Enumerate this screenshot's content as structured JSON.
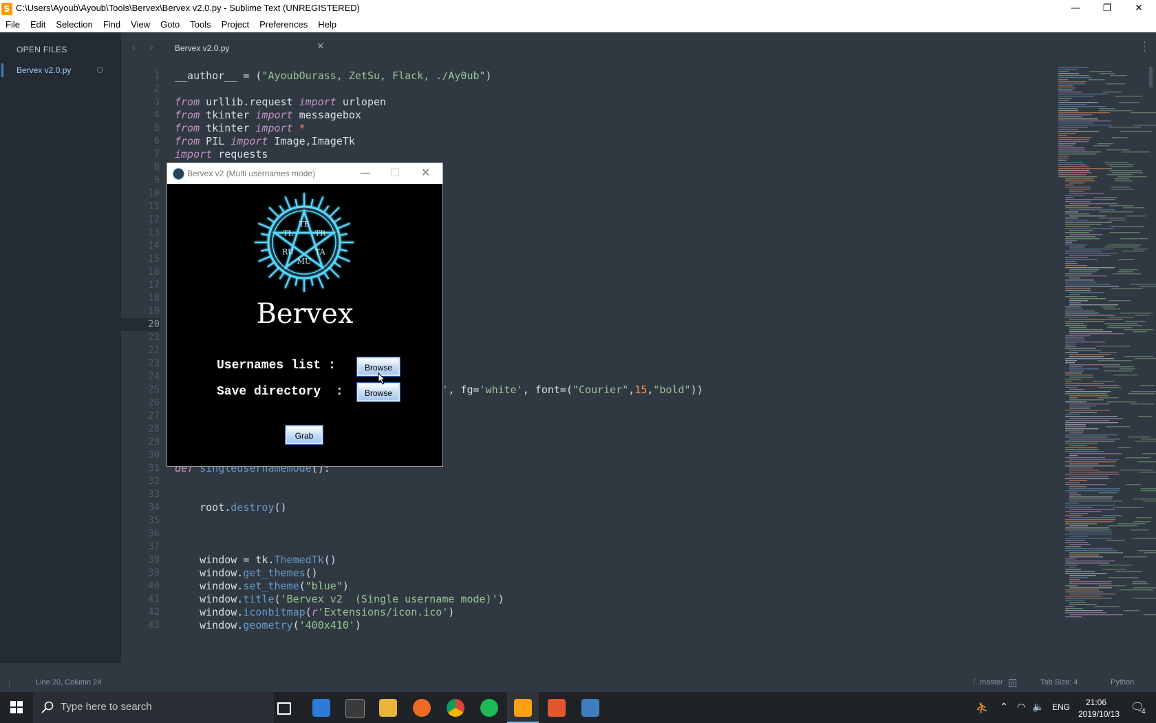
{
  "window": {
    "title": "C:\\Users\\Ayoub\\Ayoub\\Tools\\Bervex\\Bervex v2.0.py - Sublime Text (UNREGISTERED)",
    "minimize_glyph": "—",
    "maximize_glyph": "❐",
    "close_glyph": "✕"
  },
  "menu": [
    "File",
    "Edit",
    "Selection",
    "Find",
    "View",
    "Goto",
    "Tools",
    "Project",
    "Preferences",
    "Help"
  ],
  "sidebar": {
    "header": "OPEN FILES",
    "files": [
      {
        "label": "Bervex v2.0.py"
      }
    ]
  },
  "tabs": [
    {
      "label": "Bervex v2.0.py",
      "close": "×"
    }
  ],
  "editor": {
    "current_line": 20,
    "lines": [
      {
        "n": 1,
        "html": "__author__ = (<span class='str'>\"AyoubOurass, ZetSu, Flack, ./Ay0ub\"</span>)"
      },
      {
        "n": 2,
        "html": ""
      },
      {
        "n": 3,
        "html": "<span class='kw'>from</span> urllib.request <span class='kw'>import</span> urlopen"
      },
      {
        "n": 4,
        "html": "<span class='kw'>from</span> tkinter <span class='kw'>import</span> messagebox"
      },
      {
        "n": 5,
        "html": "<span class='kw'>from</span> tkinter <span class='kw'>import</span> <span class='op'>*</span>"
      },
      {
        "n": 6,
        "html": "<span class='kw'>from</span> PIL <span class='kw'>import</span> Image,ImageTk"
      },
      {
        "n": 7,
        "html": "<span class='kw'>import</span> requests"
      },
      {
        "n": 8,
        "html": ""
      },
      {
        "n": 9,
        "html": ""
      },
      {
        "n": 10,
        "html": ""
      },
      {
        "n": 11,
        "html": ""
      },
      {
        "n": 12,
        "html": ""
      },
      {
        "n": 13,
        "html": ""
      },
      {
        "n": 14,
        "html": ""
      },
      {
        "n": 15,
        "html": ""
      },
      {
        "n": 16,
        "html": ""
      },
      {
        "n": 17,
        "html": ""
      },
      {
        "n": 18,
        "html": ""
      },
      {
        "n": 19,
        "html": ""
      },
      {
        "n": 20,
        "html": ""
      },
      {
        "n": 21,
        "html": ""
      },
      {
        "n": 22,
        "html": ""
      },
      {
        "n": 23,
        "html": ""
      },
      {
        "n": 24,
        "html": ""
      },
      {
        "n": 25,
        "html": "                                   g=<span class='str'>'black'</span>, fg=<span class='str'>'white'</span>, font=(<span class='str'>\"Courier\"</span>,<span class='num'>15</span>,<span class='str'>\"bold\"</span>))"
      },
      {
        "n": 26,
        "html": ""
      },
      {
        "n": 27,
        "html": ""
      },
      {
        "n": 28,
        "html": ""
      },
      {
        "n": 29,
        "html": ""
      },
      {
        "n": 30,
        "html": ""
      },
      {
        "n": 31,
        "html": "<span class='kw'>def</span> <span class='fn'>singleusernamemode</span>():"
      },
      {
        "n": 32,
        "html": ""
      },
      {
        "n": 33,
        "html": ""
      },
      {
        "n": 34,
        "html": "    root.<span class='fn'>destroy</span>()"
      },
      {
        "n": 35,
        "html": ""
      },
      {
        "n": 36,
        "html": ""
      },
      {
        "n": 37,
        "html": ""
      },
      {
        "n": 38,
        "html": "    window = tk.<span class='fn'>ThemedTk</span>()"
      },
      {
        "n": 39,
        "html": "    window.<span class='fn'>get_themes</span>()"
      },
      {
        "n": 40,
        "html": "    window.<span class='fn'>set_theme</span>(<span class='str'>\"blue\"</span>)"
      },
      {
        "n": 41,
        "html": "    window.<span class='fn'>title</span>(<span class='str'>'Bervex v2  (Single username mode)'</span>)"
      },
      {
        "n": 42,
        "html": "    window.<span class='fn'>iconbitmap</span>(<span class='kw'>r</span><span class='str'>'Extensions/icon.ico'</span>)"
      },
      {
        "n": 43,
        "html": "    window.<span class='fn'>geometry</span>(<span class='str'>'400x410'</span>)"
      }
    ]
  },
  "bervex": {
    "title": "Bervex v2  (Multi usernames mode)",
    "brand": "Bervex",
    "logo_letters": [
      "TE",
      "TR",
      "TA",
      "MU",
      "RU",
      "TL"
    ],
    "usernames_label": "Usernames list :",
    "save_label": "Save directory  :",
    "browse1": "Browse",
    "browse2": "Browse",
    "grab": "Grab",
    "minimize": "—",
    "maximize": "☐",
    "close": "✕"
  },
  "status": {
    "position": "Line 20, Column 24",
    "branch": "master",
    "branch_badge": "0",
    "tab_size": "Tab Size: 4",
    "syntax": "Python"
  },
  "taskbar": {
    "search_placeholder": "Type here to search",
    "lang": "ENG",
    "time": "21:06",
    "date": "2019/10/13",
    "notif_count": "4"
  },
  "colors": {
    "accent": "#5fb3b3",
    "editor_bg": "#303841",
    "logo_glow": "#5ad8ff"
  }
}
